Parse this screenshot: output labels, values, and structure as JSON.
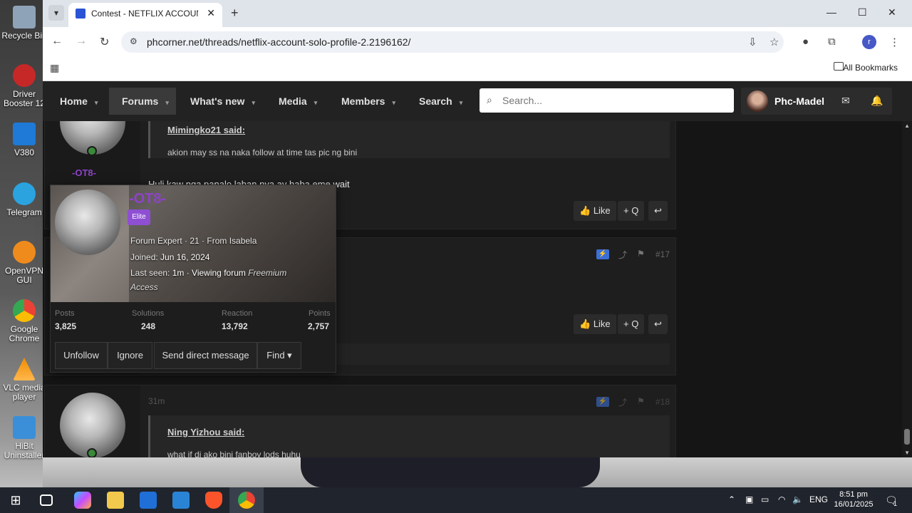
{
  "desktop": {
    "icons": [
      {
        "name": "Recycle Bin",
        "label": "Recycle Bin",
        "color": "#8fa3b8"
      },
      {
        "name": "Driver Booster",
        "label": "Driver Booster 12",
        "color": "#c62828"
      },
      {
        "name": "V380",
        "label": "V380",
        "color": "#1e7ad6"
      },
      {
        "name": "Telegram",
        "label": "Telegram",
        "color": "#2aa3df"
      },
      {
        "name": "OpenVPN GUI",
        "label": "OpenVPN GUI",
        "color": "#ef8b1d"
      },
      {
        "name": "Google Chrome",
        "label": "Google Chrome",
        "color": "#34a853"
      },
      {
        "name": "VLC media player",
        "label": "VLC media player",
        "color": "#f08c00"
      },
      {
        "name": "HiBit Uninstaller",
        "label": "HiBit Uninstaller",
        "color": "#3a8fd8"
      }
    ]
  },
  "browser": {
    "tab_title": "Contest - NETFLIX ACCOUNT SO",
    "url": "phcorner.net/threads/netflix-account-solo-profile-2.2196162/",
    "bookmarks_label": "All Bookmarks",
    "profile_initial": "r"
  },
  "site": {
    "nav": {
      "home": "Home",
      "forums": "Forums",
      "whats_new": "What's new",
      "media": "Media",
      "members": "Members",
      "search": "Search"
    },
    "search_placeholder": "Search...",
    "username": "Phc-Madel"
  },
  "posts": {
    "p1": {
      "username": "-OT8-",
      "quote_author": "Mimingko21 said:",
      "quote_text": "akion may ss na naka follow at time tas pic ng bini",
      "body": "Huli kaw nga panalo laban nya ay haba eme wait",
      "like": "Like",
      "quote_btn": "+ Q"
    },
    "p2": {
      "number": "#17",
      "like": "Like",
      "quote_btn": "+ Q"
    },
    "p3": {
      "time": "31m",
      "number": "#18",
      "quote_author": "Ning Yizhou said:",
      "quote_text": "what if di ako bini fanboy lods huhu"
    }
  },
  "member_card": {
    "username": "-OT8-",
    "badge": "Elite",
    "title_line": "Forum Expert · 21 · From Isabela",
    "joined_label": "Joined:",
    "joined": "Jun 16, 2024",
    "last_seen_label": "Last seen:",
    "last_seen": "1m · Viewing forum",
    "last_seen_where_1": "Freemium",
    "last_seen_where_2": "Access",
    "stats": {
      "posts_label": "Posts",
      "posts": "3,825",
      "solutions_label": "Solutions",
      "solutions": "248",
      "reaction_label": "Reaction",
      "reaction": "13,792",
      "points_label": "Points",
      "points": "2,757"
    },
    "buttons": {
      "unfollow": "Unfollow",
      "ignore": "Ignore",
      "dm": "Send direct message",
      "find": "Find ▾"
    }
  },
  "taskbar": {
    "time": "8:51 pm",
    "date": "16/01/2025",
    "lang": "ENG",
    "notif_count": "1"
  }
}
